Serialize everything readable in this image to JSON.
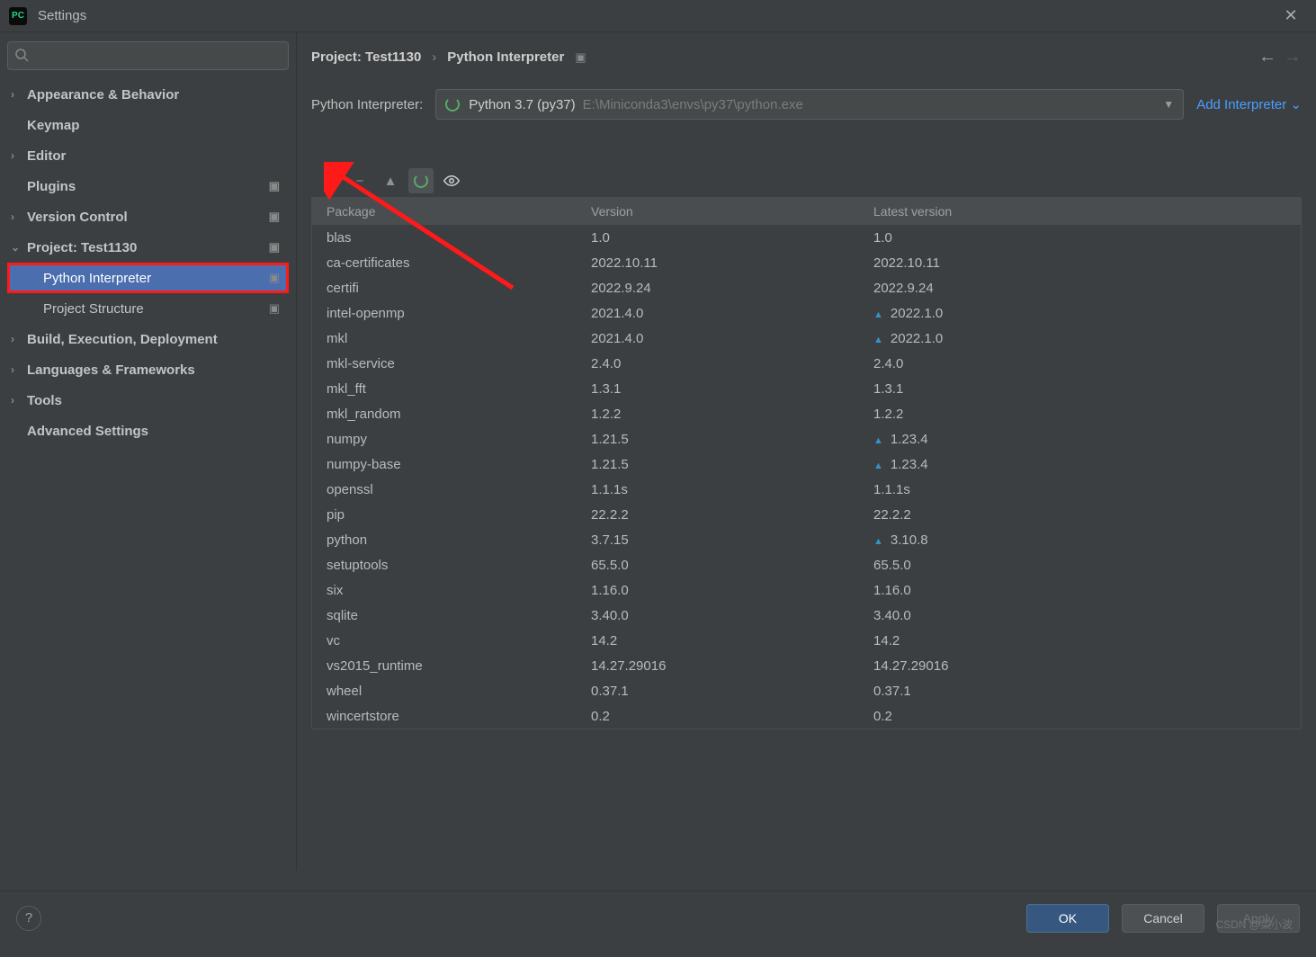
{
  "window": {
    "title": "Settings"
  },
  "search": {
    "placeholder": ""
  },
  "sidebar": {
    "items": [
      {
        "label": "Appearance & Behavior",
        "chev": true,
        "bold": true
      },
      {
        "label": "Keymap",
        "chev": false,
        "bold": true
      },
      {
        "label": "Editor",
        "chev": true,
        "bold": true
      },
      {
        "label": "Plugins",
        "chev": false,
        "bold": true,
        "pin": true
      },
      {
        "label": "Version Control",
        "chev": true,
        "bold": true,
        "pin": true
      },
      {
        "label": "Project: Test1130",
        "chev": true,
        "bold": true,
        "open": true,
        "pin": true
      },
      {
        "label": "Python Interpreter",
        "child": true,
        "selected": true,
        "highlight": true,
        "pin": true
      },
      {
        "label": "Project Structure",
        "child": true,
        "pin": true
      },
      {
        "label": "Build, Execution, Deployment",
        "chev": true,
        "bold": true
      },
      {
        "label": "Languages & Frameworks",
        "chev": true,
        "bold": true
      },
      {
        "label": "Tools",
        "chev": true,
        "bold": true
      },
      {
        "label": "Advanced Settings",
        "chev": false,
        "bold": true
      }
    ]
  },
  "breadcrumb": {
    "a": "Project: Test1130",
    "sep": "›",
    "b": "Python Interpreter"
  },
  "interpreter": {
    "label": "Python Interpreter:",
    "name": "Python 3.7 (py37)",
    "path": "E:\\Miniconda3\\envs\\py37\\python.exe",
    "add": "Add Interpreter"
  },
  "table": {
    "headers": {
      "pkg": "Package",
      "ver": "Version",
      "lat": "Latest version"
    },
    "rows": [
      {
        "pkg": "blas",
        "ver": "1.0",
        "lat": "1.0"
      },
      {
        "pkg": "ca-certificates",
        "ver": "2022.10.11",
        "lat": "2022.10.11"
      },
      {
        "pkg": "certifi",
        "ver": "2022.9.24",
        "lat": "2022.9.24"
      },
      {
        "pkg": "intel-openmp",
        "ver": "2021.4.0",
        "lat": "2022.1.0",
        "up": true
      },
      {
        "pkg": "mkl",
        "ver": "2021.4.0",
        "lat": "2022.1.0",
        "up": true
      },
      {
        "pkg": "mkl-service",
        "ver": "2.4.0",
        "lat": "2.4.0"
      },
      {
        "pkg": "mkl_fft",
        "ver": "1.3.1",
        "lat": "1.3.1"
      },
      {
        "pkg": "mkl_random",
        "ver": "1.2.2",
        "lat": "1.2.2"
      },
      {
        "pkg": "numpy",
        "ver": "1.21.5",
        "lat": "1.23.4",
        "up": true
      },
      {
        "pkg": "numpy-base",
        "ver": "1.21.5",
        "lat": "1.23.4",
        "up": true
      },
      {
        "pkg": "openssl",
        "ver": "1.1.1s",
        "lat": "1.1.1s"
      },
      {
        "pkg": "pip",
        "ver": "22.2.2",
        "lat": "22.2.2"
      },
      {
        "pkg": "python",
        "ver": "3.7.15",
        "lat": "3.10.8",
        "up": true
      },
      {
        "pkg": "setuptools",
        "ver": "65.5.0",
        "lat": "65.5.0"
      },
      {
        "pkg": "six",
        "ver": "1.16.0",
        "lat": "1.16.0"
      },
      {
        "pkg": "sqlite",
        "ver": "3.40.0",
        "lat": "3.40.0"
      },
      {
        "pkg": "vc",
        "ver": "14.2",
        "lat": "14.2"
      },
      {
        "pkg": "vs2015_runtime",
        "ver": "14.27.29016",
        "lat": "14.27.29016"
      },
      {
        "pkg": "wheel",
        "ver": "0.37.1",
        "lat": "0.37.1"
      },
      {
        "pkg": "wincertstore",
        "ver": "0.2",
        "lat": "0.2"
      }
    ]
  },
  "footer": {
    "ok": "OK",
    "cancel": "Cancel",
    "apply": "Apply"
  },
  "watermark": "CSDN @菜小波"
}
